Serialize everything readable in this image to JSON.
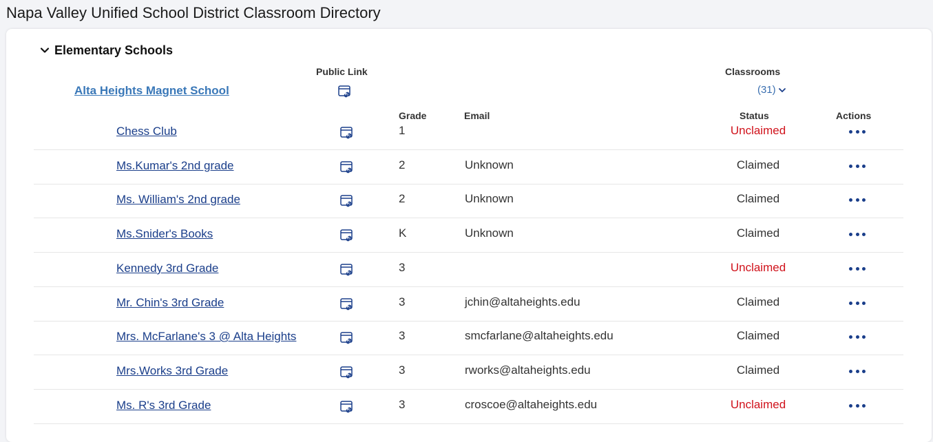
{
  "page": {
    "title": "Napa Valley Unified School District Classroom Directory"
  },
  "section": {
    "title": "Elementary Schools"
  },
  "headers": {
    "public_link": "Public Link",
    "classrooms": "Classrooms",
    "grade": "Grade",
    "email": "Email",
    "status": "Status",
    "actions": "Actions"
  },
  "school": {
    "name": "Alta Heights Magnet School",
    "classroom_count": "(31)"
  },
  "colors": {
    "link": "#1a3e8a",
    "school_link": "#3a78b8",
    "unclaimed": "#d0121b"
  },
  "rows": [
    {
      "name": "Chess Club",
      "grade": "1",
      "email": "",
      "status": "Unclaimed"
    },
    {
      "name": "Ms.Kumar's 2nd grade",
      "grade": "2",
      "email": "Unknown",
      "status": "Claimed"
    },
    {
      "name": "Ms. William's 2nd grade",
      "grade": "2",
      "email": "Unknown",
      "status": "Claimed"
    },
    {
      "name": "Ms.Snider's Books",
      "grade": "K",
      "email": "Unknown",
      "status": "Claimed"
    },
    {
      "name": "Kennedy 3rd Grade",
      "grade": "3",
      "email": "",
      "status": "Unclaimed"
    },
    {
      "name": "Mr. Chin's 3rd Grade",
      "grade": "3",
      "email": "jchin@altaheights.edu",
      "status": "Claimed"
    },
    {
      "name": "Mrs. McFarlane's 3 @ Alta Heights",
      "grade": "3",
      "email": "smcfarlane@altaheights.edu",
      "status": "Claimed"
    },
    {
      "name": "Mrs.Works 3rd Grade",
      "grade": "3",
      "email": "rworks@altaheights.edu",
      "status": "Claimed"
    },
    {
      "name": "Ms. R's 3rd Grade",
      "grade": "3",
      "email": "croscoe@altaheights.edu",
      "status": "Unclaimed"
    }
  ]
}
